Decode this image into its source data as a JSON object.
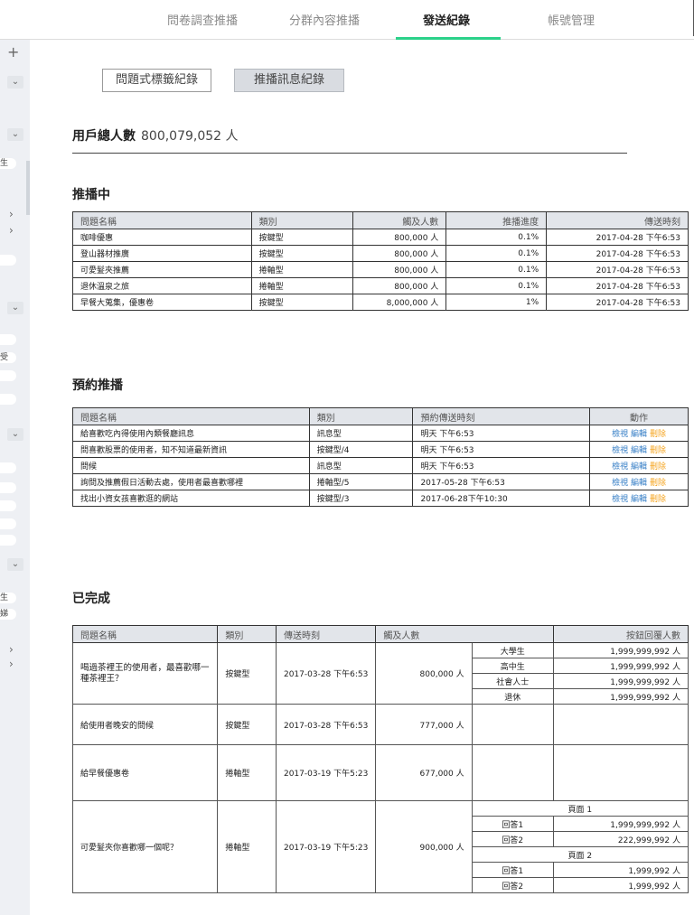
{
  "nav": {
    "tabs": [
      "問卷調查推播",
      "分群內容推播",
      "發送紀錄",
      "帳號管理"
    ],
    "active": 2
  },
  "sidebar": {
    "plus": "+",
    "chevron": "⌄",
    "arrow": "›",
    "pills": [
      "生",
      "受",
      "生",
      "娣"
    ]
  },
  "buttons": {
    "tag_records": "問題式標籤紀錄",
    "push_records": "推播訊息紀錄"
  },
  "total_users": {
    "label": "用戶總人數",
    "value": "800,079,052 人"
  },
  "pushing": {
    "title": "推播中",
    "headers": [
      "問題名稱",
      "類別",
      "觸及人數",
      "推播進度",
      "傳送時刻"
    ],
    "rows": [
      [
        "咖啡優惠",
        "按鍵型",
        "800,000 人",
        "0.1%",
        "2017-04-28 下午6:53"
      ],
      [
        "登山器材推廣",
        "按鍵型",
        "800,000 人",
        "0.1%",
        "2017-04-28 下午6:53"
      ],
      [
        "可愛髮夾推薦",
        "捲軸型",
        "800,000 人",
        "0.1%",
        "2017-04-28 下午6:53"
      ],
      [
        "退休溫泉之旅",
        "捲軸型",
        "800,000 人",
        "0.1%",
        "2017-04-28 下午6:53"
      ],
      [
        "早餐大蒐集，優惠卷",
        "按鍵型",
        "8,000,000 人",
        "1%",
        "2017-04-28 下午6:53"
      ]
    ]
  },
  "scheduled": {
    "title": "預約推播",
    "headers": [
      "問題名稱",
      "類別",
      "預約傳送時刻",
      "動作"
    ],
    "rows": [
      [
        "給喜歡吃內得使用內類餐廳訊息",
        "訊息型",
        "明天 下午6:53"
      ],
      [
        "問喜歡股票的使用者，知不知道最新資訊",
        "按鍵型/4",
        "明天 下午6:53"
      ],
      [
        "問候",
        "訊息型",
        "明天 下午6:53"
      ],
      [
        "詢問及推薦假日活動去處，使用者最喜歡哪裡",
        "捲軸型/5",
        "2017-05-28 下午6:53"
      ],
      [
        "找出小資女孩喜歡逛的網站",
        "按鍵型/3",
        "2017-06-28下午10:30"
      ]
    ],
    "actions": {
      "view": "檢視",
      "edit": "編輯",
      "delete": "刪除"
    }
  },
  "completed": {
    "title": "已完成",
    "headers": [
      "問題名稱",
      "類別",
      "傳送時刻",
      "觸及人數",
      "按鈕回覆人數"
    ],
    "rows": [
      {
        "name": "喝過茶裡王的使用者，最喜歡哪一種茶裡王？",
        "type": "按鍵型",
        "time": "2017-03-28 下午6:53",
        "reach": "800,000 人",
        "answers": [
          [
            "大學生",
            "1,999,999,992 人"
          ],
          [
            "高中生",
            "1,999,999,992 人"
          ],
          [
            "社會人士",
            "1,999,999,992 人"
          ],
          [
            "退休",
            "1,999,999,992 人"
          ]
        ]
      },
      {
        "name": "給使用者晚安的問候",
        "type": "按鍵型",
        "time": "2017-03-28 下午6:53",
        "reach": "777,000 人"
      },
      {
        "name": "給早餐優惠卷",
        "type": "捲軸型",
        "time": "2017-03-19 下午5:23",
        "reach": "677,000 人"
      },
      {
        "name": "可愛髮夾你喜歡哪一個呢？",
        "type": "捲軸型",
        "time": "2017-03-19 下午5:23",
        "reach": "900,000 人",
        "pages": [
          {
            "label": "頁面 1",
            "answers": [
              [
                "回答1",
                "1,999,999,992 人"
              ],
              [
                "回答2",
                "222,999,992 人"
              ]
            ]
          },
          {
            "label": "頁面 2",
            "answers": [
              [
                "回答1",
                "1,999,992 人"
              ],
              [
                "回答2",
                "1,999,992 人"
              ]
            ]
          }
        ]
      }
    ]
  }
}
